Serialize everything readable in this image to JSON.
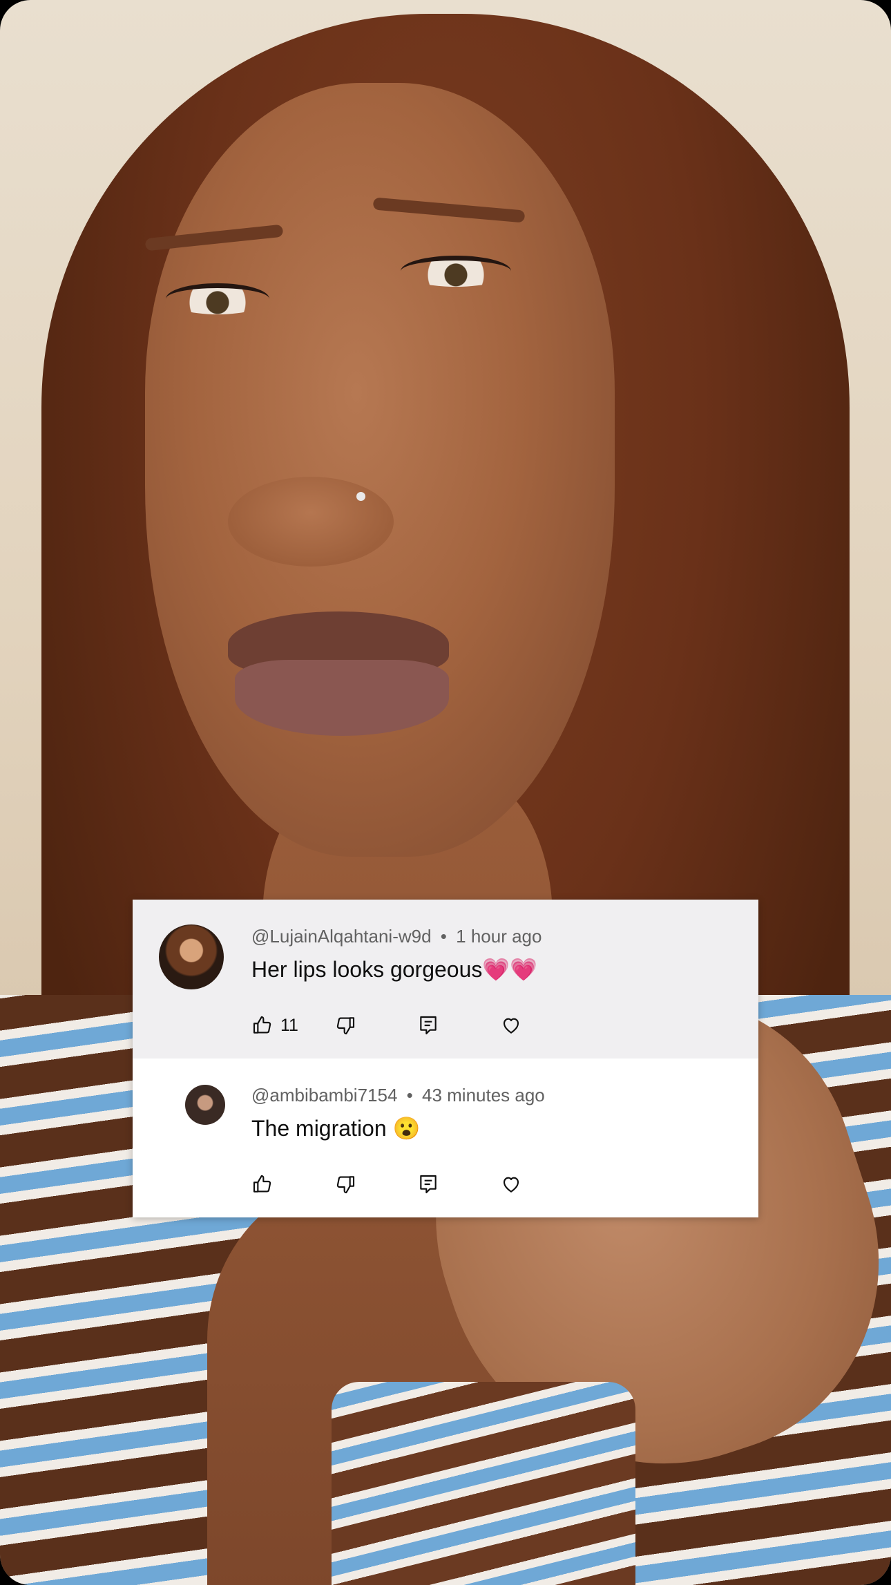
{
  "comments": [
    {
      "username": "@LujainAlqahtani-w9d",
      "separator": "•",
      "time": "1 hour ago",
      "text": "Her lips looks gorgeous💗💗",
      "likes": "11",
      "highlighted": true
    },
    {
      "username": "@ambibambi7154",
      "separator": "•",
      "time": "43 minutes ago",
      "text": "The migration 😮",
      "likes": "",
      "highlighted": false
    }
  ],
  "icons": [
    "thumbs-up-icon",
    "thumbs-down-icon",
    "reply-icon",
    "heart-icon"
  ],
  "colors": {
    "card_bg": "#ffffff",
    "highlight_bg": "#f0eff1",
    "meta_text": "#616161",
    "body_text": "#0f0f0f"
  }
}
